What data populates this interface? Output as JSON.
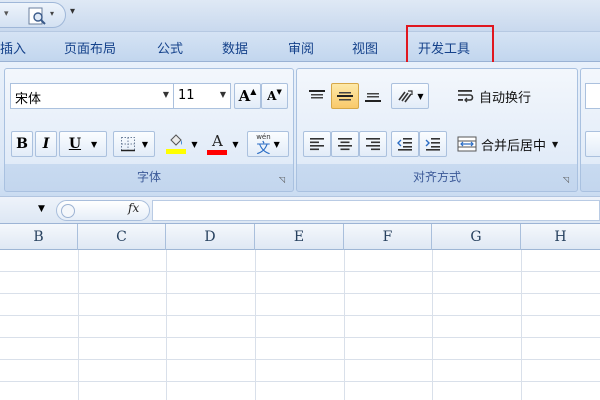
{
  "qat": {
    "more_glyph": "▾"
  },
  "tabs": [
    {
      "label": "插入"
    },
    {
      "label": "页面布局"
    },
    {
      "label": "公式"
    },
    {
      "label": "数据"
    },
    {
      "label": "审阅"
    },
    {
      "label": "视图"
    },
    {
      "label": "开发工具"
    }
  ],
  "font_group": {
    "font_name": "宋体",
    "font_size": "11",
    "grow_label": "A",
    "shrink_label": "A",
    "bold_label": "B",
    "italic_label": "I",
    "underline_label": "U",
    "font_color_label": "A",
    "phonetic_top": "wén",
    "phonetic_char": "文",
    "group_label": "字体"
  },
  "align_group": {
    "wrap_text_label": "自动换行",
    "merge_center_label": "合并后居中",
    "group_label": "对齐方式"
  },
  "formula_bar": {
    "fx_label": "fx"
  },
  "columns": [
    "B",
    "C",
    "D",
    "E",
    "F",
    "G",
    "H"
  ],
  "colors": {
    "highlight_border": "#e0171f",
    "fill_yellow": "#ffff00",
    "font_red": "#ff0000",
    "tab_text": "#15428b"
  }
}
